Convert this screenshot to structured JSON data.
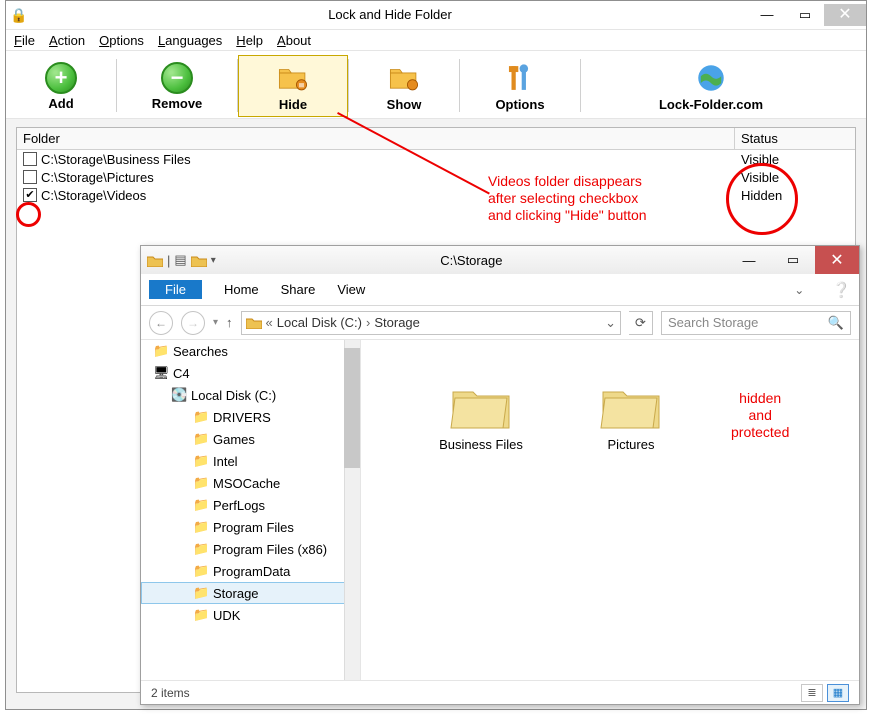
{
  "app": {
    "title": "Lock and Hide Folder",
    "menus": [
      {
        "label": "File",
        "ul": "F",
        "rest": "ile"
      },
      {
        "label": "Action",
        "ul": "A",
        "rest": "ction"
      },
      {
        "label": "Options",
        "ul": "O",
        "rest": "ptions"
      },
      {
        "label": "Languages",
        "ul": "L",
        "rest": "anguages"
      },
      {
        "label": "Help",
        "ul": "H",
        "rest": "elp"
      },
      {
        "label": "About",
        "ul": "A",
        "rest": "bout"
      }
    ],
    "toolbar": {
      "add": "Add",
      "remove": "Remove",
      "hide": "Hide",
      "show": "Show",
      "options": "Options",
      "site": "Lock-Folder.com"
    },
    "grid": {
      "col_folder": "Folder",
      "col_status": "Status",
      "rows": [
        {
          "checked": false,
          "path": "C:\\Storage\\Business Files",
          "status": "Visible"
        },
        {
          "checked": false,
          "path": "C:\\Storage\\Pictures",
          "status": "Visible"
        },
        {
          "checked": true,
          "path": "C:\\Storage\\Videos",
          "status": "Hidden"
        }
      ]
    }
  },
  "annotation": {
    "line1": "Videos folder disappears",
    "line2": "after selecting checkbox",
    "line3": "and clicking \"Hide\" button",
    "hidden1": "hidden",
    "hidden2": "and",
    "hidden3": "protected"
  },
  "explorer": {
    "title": "C:\\Storage",
    "ribbon": {
      "file": "File",
      "home": "Home",
      "share": "Share",
      "view": "View"
    },
    "breadcrumb": {
      "pre": "«",
      "seg1": "Local Disk (C:)",
      "seg2": "Storage"
    },
    "search_placeholder": "Search Storage",
    "items_label": "2 items",
    "tree": [
      {
        "label": "Searches",
        "indent": 1,
        "ico": "📁"
      },
      {
        "label": "C4",
        "indent": 1,
        "ico": "🖥"
      },
      {
        "label": "Local Disk (C:)",
        "indent": 2,
        "ico": "💽"
      },
      {
        "label": "DRIVERS",
        "indent": 3,
        "ico": "📁"
      },
      {
        "label": "Games",
        "indent": 3,
        "ico": "📁"
      },
      {
        "label": "Intel",
        "indent": 3,
        "ico": "📁"
      },
      {
        "label": "MSOCache",
        "indent": 3,
        "ico": "📁"
      },
      {
        "label": "PerfLogs",
        "indent": 3,
        "ico": "📁"
      },
      {
        "label": "Program Files",
        "indent": 3,
        "ico": "📁"
      },
      {
        "label": "Program Files (x86)",
        "indent": 3,
        "ico": "📁"
      },
      {
        "label": "ProgramData",
        "indent": 3,
        "ico": "📁"
      },
      {
        "label": "Storage",
        "indent": 3,
        "ico": "📁",
        "sel": true
      },
      {
        "label": "UDK",
        "indent": 3,
        "ico": "📁"
      }
    ],
    "content": [
      {
        "label": "Business Files"
      },
      {
        "label": "Pictures"
      }
    ]
  }
}
